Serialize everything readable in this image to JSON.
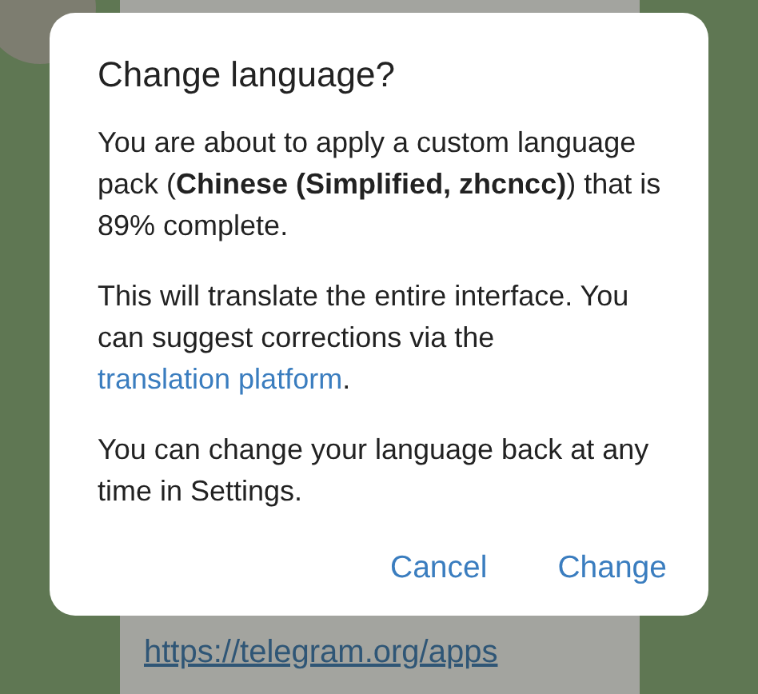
{
  "chat": {
    "link": "https://telegram.org/apps"
  },
  "dialog": {
    "title": "Change language?",
    "paragraphs": [
      "You are about to apply a custom language pack (**Chinese (Simplified, zhcncc)**) that is 89% complete.",
      "This will translate the entire interface. You can suggest corrections via the ",
      "You can change your language back at any time in Settings."
    ],
    "link": "translation platform",
    "link_after": ".",
    "buttons": [
      "Cancel",
      "Change"
    ]
  }
}
